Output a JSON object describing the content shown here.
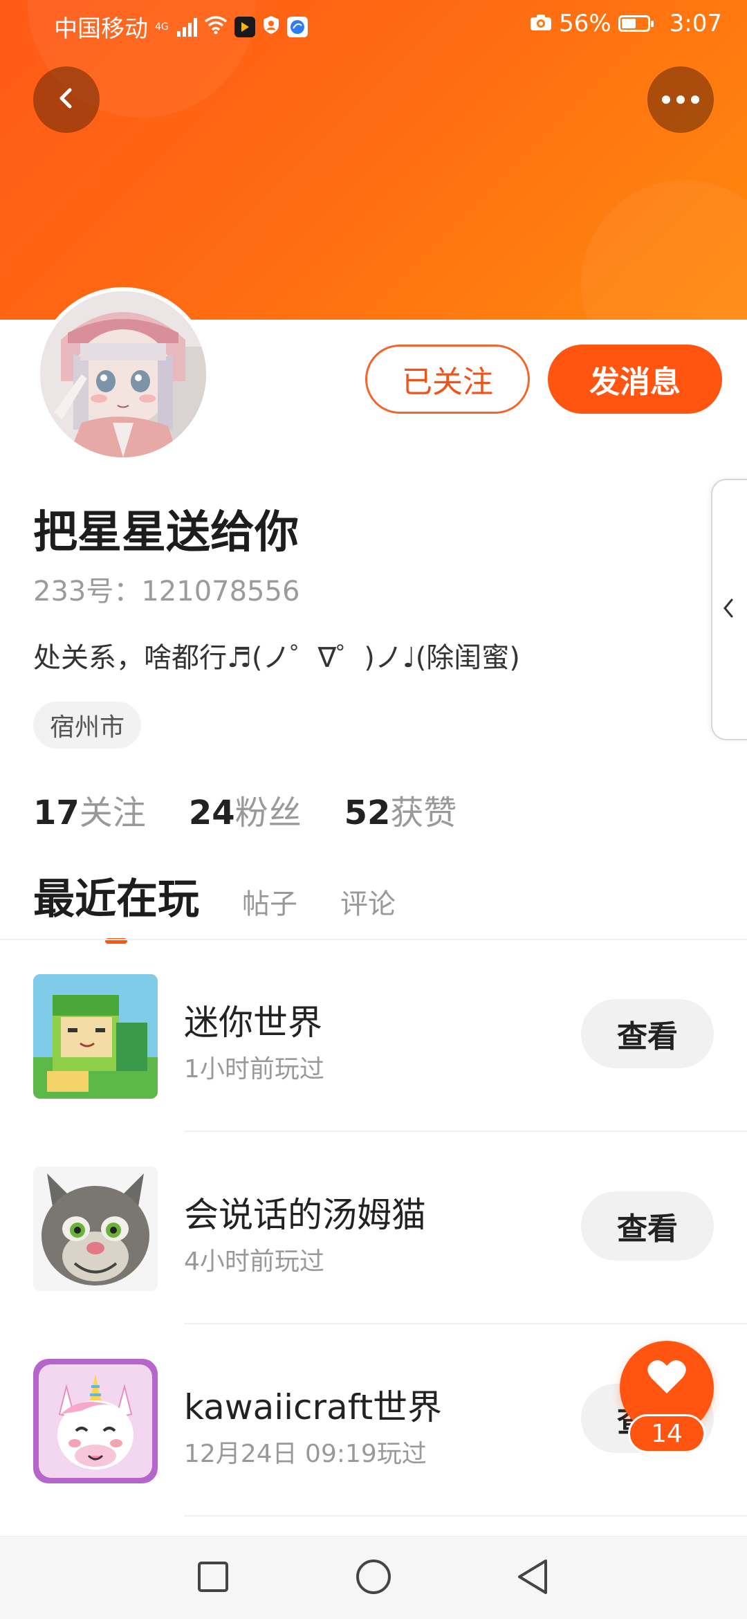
{
  "status_bar": {
    "carrier": "中国移动",
    "network_tag": "4G",
    "battery_percent": "56%",
    "battery_level": 0.56,
    "time": "3:07"
  },
  "header": {
    "back_icon": "chevron-left-icon",
    "more_icon": "more-horizontal-icon"
  },
  "profile": {
    "username": "把星星送给你",
    "id_text": "233号：121078556",
    "bio": "处关系，啥都行♬(ノ゜∇゜)ノ♩(除闺蜜)",
    "location": "宿州市",
    "followed_label": "已关注",
    "message_label": "发消息"
  },
  "stats": [
    {
      "num": "17",
      "label": "关注"
    },
    {
      "num": "24",
      "label": "粉丝"
    },
    {
      "num": "52",
      "label": "获赞"
    }
  ],
  "tabs": [
    {
      "label": "最近在玩",
      "active": true
    },
    {
      "label": "帖子",
      "active": false
    },
    {
      "label": "评论",
      "active": false
    }
  ],
  "games": [
    {
      "name": "迷你世界",
      "time": "1小时前玩过",
      "button": "查看"
    },
    {
      "name": "会说话的汤姆猫",
      "time": "4小时前玩过",
      "button": "查看"
    },
    {
      "name": "kawaiicraft世界",
      "time": "12月24日 09:19玩过",
      "button": "查看"
    }
  ],
  "like": {
    "count": "14",
    "icon": "heart-icon"
  },
  "colors": {
    "accent": "#ff5511",
    "banner_start": "#ff5a18",
    "banner_end": "#ff8a0e"
  }
}
